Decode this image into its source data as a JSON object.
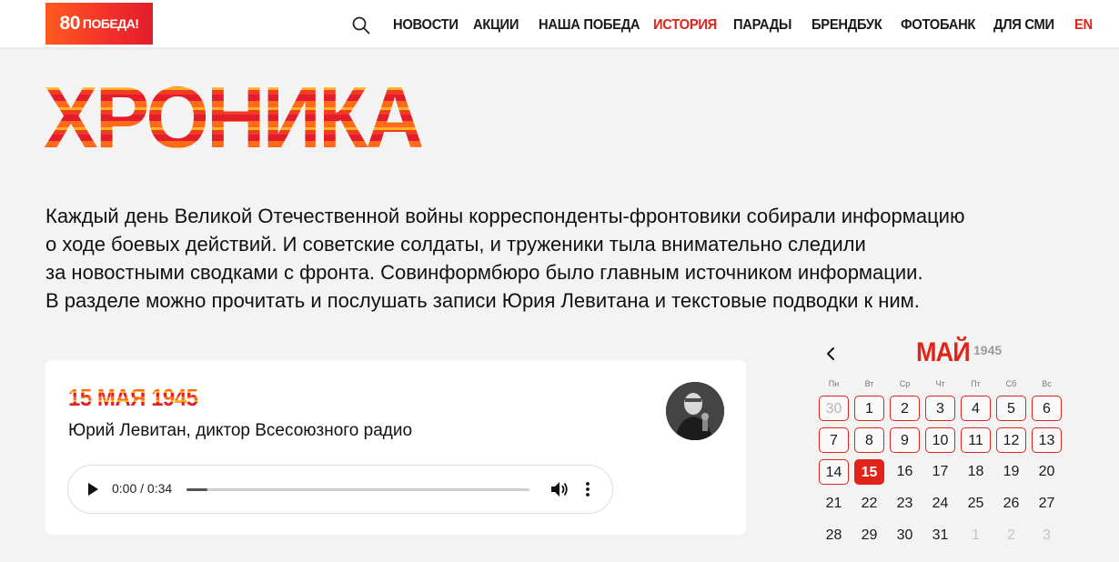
{
  "header": {
    "logo_number": "80",
    "logo_text": "ПОБЕДА!",
    "nav": [
      {
        "label": "НОВОСТИ",
        "active": false
      },
      {
        "label": "АКЦИИ",
        "active": false
      },
      {
        "label": "НАША ПОБЕДА",
        "active": false
      },
      {
        "label": "ИСТОРИЯ",
        "active": true
      },
      {
        "label": "ПАРАДЫ",
        "active": false
      },
      {
        "label": "БРЕНДБУК",
        "active": false
      },
      {
        "label": "ФОТОБАНК",
        "active": false
      },
      {
        "label": "ДЛЯ СМИ",
        "active": false
      },
      {
        "label": "EN",
        "active": true
      }
    ],
    "icons": {
      "search": "search-icon"
    }
  },
  "page": {
    "title": "ХРОНИКА",
    "intro_lines": [
      "Каждый день Великой Отечественной войны корреспонденты-фронтовики собирали информацию",
      "о ходе боевых действий. И советские солдаты, и труженики тыла внимательно следили",
      "за новостными сводками с фронта. Совинформбюро было главным источником информации.",
      "В разделе можно прочитать и послушать записи Юрия Левитана и текстовые подводки к ним."
    ]
  },
  "card": {
    "date": "15 МАЯ 1945",
    "author": "Юрий Левитан, диктор Всесоюзного радио",
    "player": {
      "time": "0:00 / 0:34",
      "progress_fraction": 0.06
    }
  },
  "calendar": {
    "month": "МАЙ",
    "year": "1945",
    "weekdays": [
      "Пн",
      "Вт",
      "Ср",
      "Чт",
      "Пт",
      "Сб",
      "Вс"
    ],
    "weeks": [
      [
        {
          "d": "30",
          "state": "muted-linked"
        },
        {
          "d": "1",
          "state": "linked"
        },
        {
          "d": "2",
          "state": "linked"
        },
        {
          "d": "3",
          "state": "linked"
        },
        {
          "d": "4",
          "state": "linked"
        },
        {
          "d": "5",
          "state": "linked"
        },
        {
          "d": "6",
          "state": "linked"
        }
      ],
      [
        {
          "d": "7",
          "state": "linked"
        },
        {
          "d": "8",
          "state": "linked"
        },
        {
          "d": "9",
          "state": "linked"
        },
        {
          "d": "10",
          "state": "linked"
        },
        {
          "d": "11",
          "state": "linked"
        },
        {
          "d": "12",
          "state": "linked"
        },
        {
          "d": "13",
          "state": "linked"
        }
      ],
      [
        {
          "d": "14",
          "state": "linked"
        },
        {
          "d": "15",
          "state": "active"
        },
        {
          "d": "16",
          "state": "plain"
        },
        {
          "d": "17",
          "state": "plain"
        },
        {
          "d": "18",
          "state": "plain"
        },
        {
          "d": "19",
          "state": "plain"
        },
        {
          "d": "20",
          "state": "plain"
        }
      ],
      [
        {
          "d": "21",
          "state": "plain"
        },
        {
          "d": "22",
          "state": "plain"
        },
        {
          "d": "23",
          "state": "plain"
        },
        {
          "d": "24",
          "state": "plain"
        },
        {
          "d": "25",
          "state": "plain"
        },
        {
          "d": "26",
          "state": "plain"
        },
        {
          "d": "27",
          "state": "plain"
        }
      ],
      [
        {
          "d": "28",
          "state": "plain"
        },
        {
          "d": "29",
          "state": "plain"
        },
        {
          "d": "30",
          "state": "plain"
        },
        {
          "d": "31",
          "state": "plain"
        },
        {
          "d": "1",
          "state": "next"
        },
        {
          "d": "2",
          "state": "next"
        },
        {
          "d": "3",
          "state": "next"
        }
      ]
    ]
  },
  "colors": {
    "accent": "#e2231a",
    "background": "#f3f3f3"
  }
}
